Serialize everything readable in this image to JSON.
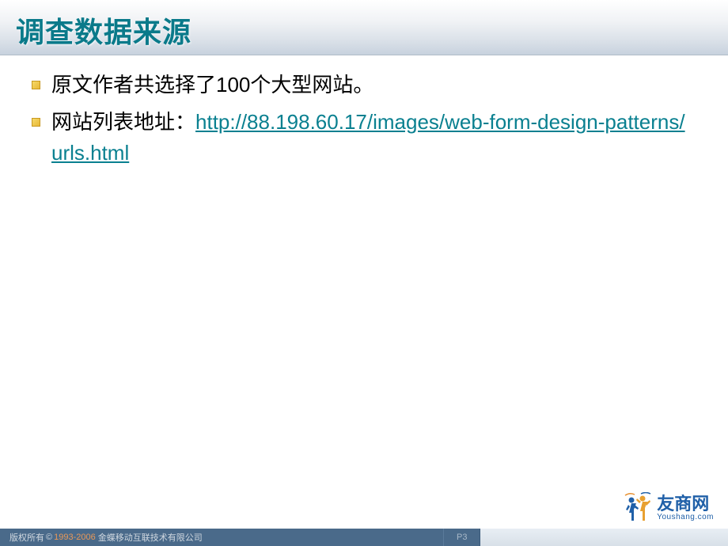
{
  "header": {
    "title": "调查数据来源"
  },
  "content": {
    "bullets": [
      {
        "text": "原文作者共选择了100个大型网站。"
      },
      {
        "prefix": "网站列表地址：",
        "link": "http://88.198.60.17/images/web-form-design-patterns/urls.html"
      }
    ]
  },
  "logo": {
    "main": "友商网",
    "sub": "Youshang.com"
  },
  "footer": {
    "copyright_prefix": "版权所有",
    "copyright_symbol": "©",
    "year_range": "1993-2006",
    "company": "金蝶移动互联技术有限公司",
    "page": "P3"
  }
}
